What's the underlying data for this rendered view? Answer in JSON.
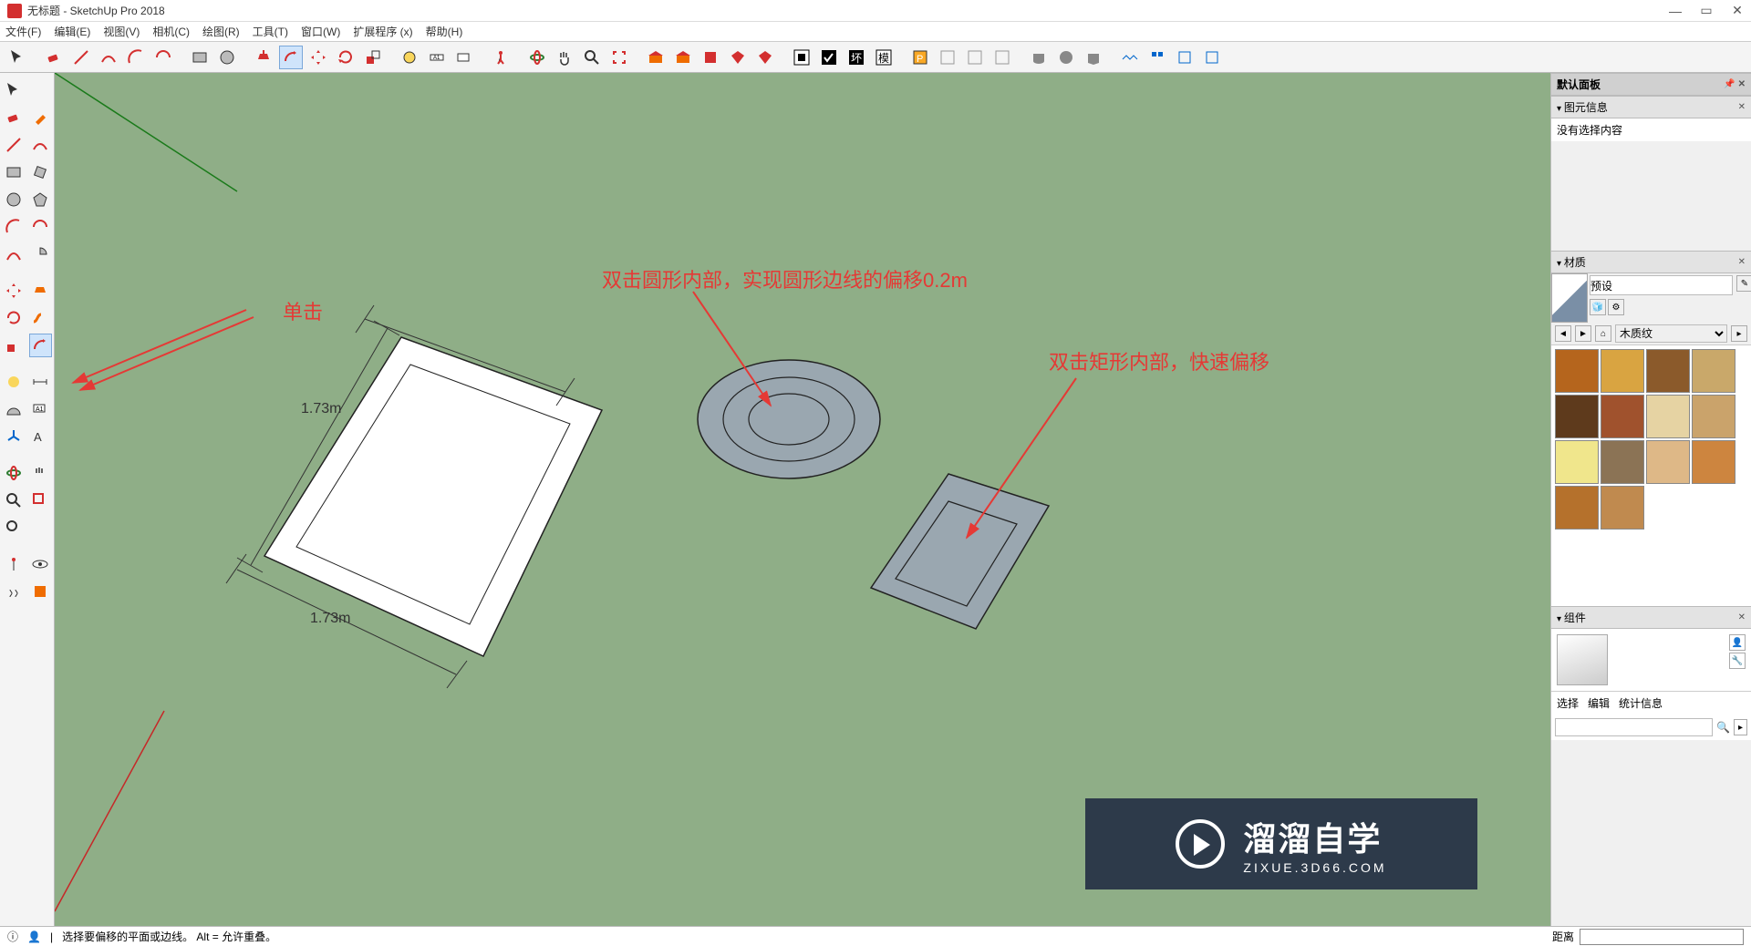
{
  "window": {
    "title": "无标题 - SketchUp Pro 2018"
  },
  "menu": [
    "文件(F)",
    "编辑(E)",
    "视图(V)",
    "相机(C)",
    "绘图(R)",
    "工具(T)",
    "窗口(W)",
    "扩展程序 (x)",
    "帮助(H)"
  ],
  "annotations": {
    "a1": "单击",
    "a2": "双击圆形内部，实现圆形边线的偏移0.2m",
    "a3": "双击矩形内部，快速偏移"
  },
  "dimensions": {
    "d1": "1.73m",
    "d2": "1.73m"
  },
  "right_panel": {
    "main_header": "默认面板",
    "entity_info_header": "图元信息",
    "entity_info_body": "没有选择内容",
    "material_header": "材质",
    "material_preset": "预设",
    "material_nav_label": "木质纹",
    "component_header": "组件",
    "component_tabs": [
      "选择",
      "编辑",
      "统计信息"
    ]
  },
  "status": {
    "hint": "选择要偏移的平面或边线。 Alt = 允许重叠。",
    "distance_label": "距离"
  },
  "watermark": {
    "title": "溜溜自学",
    "sub": "ZIXUE.3D66.COM"
  },
  "swatches": [
    "#b5651d",
    "#d9a441",
    "#8b5a2b",
    "#c9a86a",
    "#5e3a1c",
    "#a0522d",
    "#e6d3a3",
    "#caa36b",
    "#f0e68c",
    "#8b7355",
    "#deb887",
    "#cd853f",
    "#b5712c",
    "#c08a4f"
  ]
}
